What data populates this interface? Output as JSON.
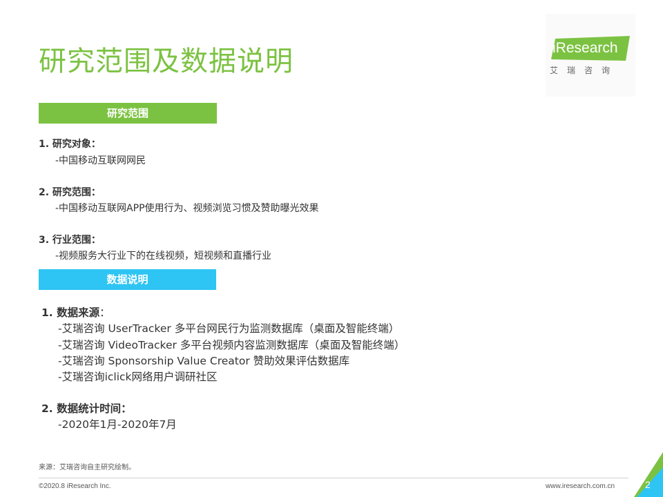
{
  "page_title": "研究范围及数据说明",
  "logo": {
    "brand_text": "iResearch",
    "cn_text": "艾瑞咨询"
  },
  "scope_section": {
    "tag_label": "研究范围",
    "items": [
      {
        "heading": "1.  研究对象：",
        "detail": "-中国移动互联网网民"
      },
      {
        "heading": "2.  研究范围：",
        "detail": "-中国移动互联网APP使用行为、视频浏览习惯及赞助曝光效果"
      },
      {
        "heading": "3.  行业范围：",
        "detail": "-视频服务大行业下的在线视频，短视频和直播行业"
      }
    ]
  },
  "data_section": {
    "tag_label": "数据说明",
    "source_heading": "1.  数据来源",
    "source_colon": "：",
    "sources": [
      "-艾瑞咨询 UserTracker 多平台网民行为监测数据库（桌面及智能终端）",
      "-艾瑞咨询 VideoTracker 多平台视频内容监测数据库（桌面及智能终端）",
      "-艾瑞咨询 Sponsorship Value Creator 赞助效果评估数据库",
      "-艾瑞咨询iclick网络用户调研社区"
    ],
    "time_heading": "2.  数据统计时间：",
    "time_detail": "-2020年1月-2020年7月"
  },
  "footer": {
    "source_note": "来源：艾瑞咨询自主研究绘制。",
    "copyright": "©2020.8 iResearch Inc.",
    "website": "www.iresearch.com.cn",
    "page_number": "2"
  },
  "colors": {
    "green": "#7cc242",
    "cyan": "#2ec4f3",
    "text": "#333333"
  }
}
